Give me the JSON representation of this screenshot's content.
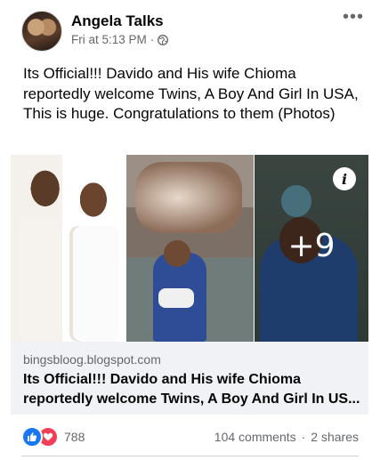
{
  "post": {
    "author": "Angela Talks",
    "time": "Fri at 5:13 PM",
    "separator": "·",
    "text": "Its Official!!! Davido and His wife Chioma reportedly welcome Twins, A Boy And Girl In USA, This is huge. Congratulations to them (Photos)",
    "media_more_count": "+9"
  },
  "link": {
    "domain": "bingsbloog.blogspot.com",
    "title_line1": "Its Official!!! Davido and His wife Chioma",
    "title_line2": "reportedly welcome Twins, A Boy And Girl In US..."
  },
  "footer": {
    "reactions_count": "788",
    "comments": "104 comments",
    "dot": "·",
    "shares": "2 shares"
  },
  "colors": {
    "like": "#1877f2",
    "love": "#f33e58",
    "secondary_text": "#65676b",
    "link_bg": "#f0f2f5"
  },
  "icons": [
    "more-icon",
    "globe-icon",
    "info-icon",
    "like-icon",
    "love-icon"
  ]
}
